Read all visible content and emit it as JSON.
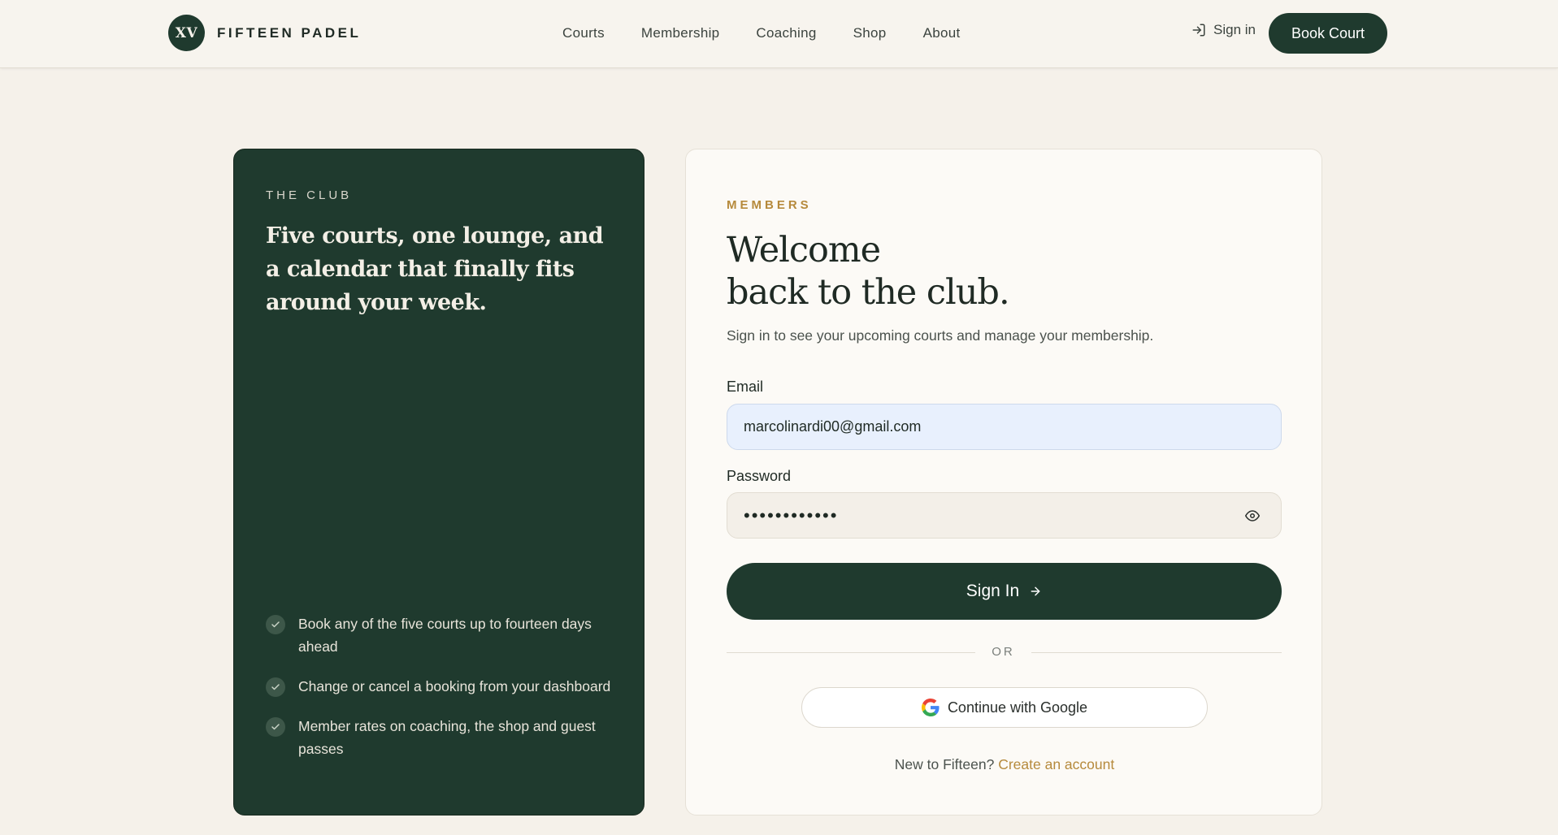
{
  "brand": {
    "mark": "XV",
    "name": "FIFTEEN PADEL"
  },
  "nav": {
    "items": [
      {
        "label": "Courts"
      },
      {
        "label": "Membership"
      },
      {
        "label": "Coaching"
      },
      {
        "label": "Shop"
      },
      {
        "label": "About"
      }
    ],
    "sign_in_label": "Sign in",
    "book_court_label": "Book Court"
  },
  "club": {
    "eyebrow": "THE CLUB",
    "headline": "Five courts, one lounge, and a calendar that finally fits around your week.",
    "benefits": [
      {
        "text": "Book any of the five courts up to fourteen days ahead"
      },
      {
        "text": "Change or cancel a booking from your dashboard"
      },
      {
        "text": "Member rates on coaching, the shop and guest passes"
      }
    ]
  },
  "form": {
    "eyebrow": "MEMBERS",
    "title_line1": "Welcome",
    "title_line2": "back to the club.",
    "subtitle": "Sign in to see your upcoming courts and manage your membership.",
    "email_label": "Email",
    "email_value": "marcolinardi00@gmail.com",
    "password_label": "Password",
    "password_value": "••••••••••••",
    "submit_label": "Sign In",
    "divider_text": "OR",
    "google_label": "Continue with Google",
    "new_prompt": "New to Fifteen?",
    "create_link": "Create an account"
  },
  "icons": {
    "sign_in": "sign-in-icon",
    "check": "check-icon",
    "eye": "eye-icon",
    "arrow": "arrow-right-icon",
    "google": "google-icon"
  },
  "colors": {
    "primary": "#1f3a2e",
    "accent": "#b68a3c",
    "background": "#f5f1ea",
    "email_fill": "#e8f0fd"
  }
}
